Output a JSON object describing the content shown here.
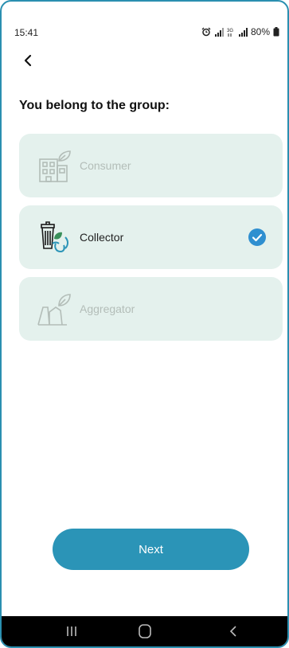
{
  "status_bar": {
    "time": "15:41",
    "battery": "80%",
    "icons": [
      "alarm-icon",
      "signal-icon",
      "data-icon",
      "signal-icon",
      "battery-icon"
    ]
  },
  "header": {
    "back_icon": "back-arrow-icon",
    "title": "You belong to the group:"
  },
  "options": [
    {
      "label": "Consumer",
      "icon": "building-leaf-icon",
      "state": "disabled"
    },
    {
      "label": "Collector",
      "icon": "bin-recycle-icon",
      "state": "selected"
    },
    {
      "label": "Aggregator",
      "icon": "factory-leaf-icon",
      "state": "disabled"
    }
  ],
  "next_button": {
    "label": "Next"
  },
  "colors": {
    "accent": "#2b94b7",
    "card_bg": "#e4f1ed",
    "check": "#2f8fd0"
  },
  "nav_bar": [
    "recents-icon",
    "home-icon",
    "back-icon"
  ]
}
